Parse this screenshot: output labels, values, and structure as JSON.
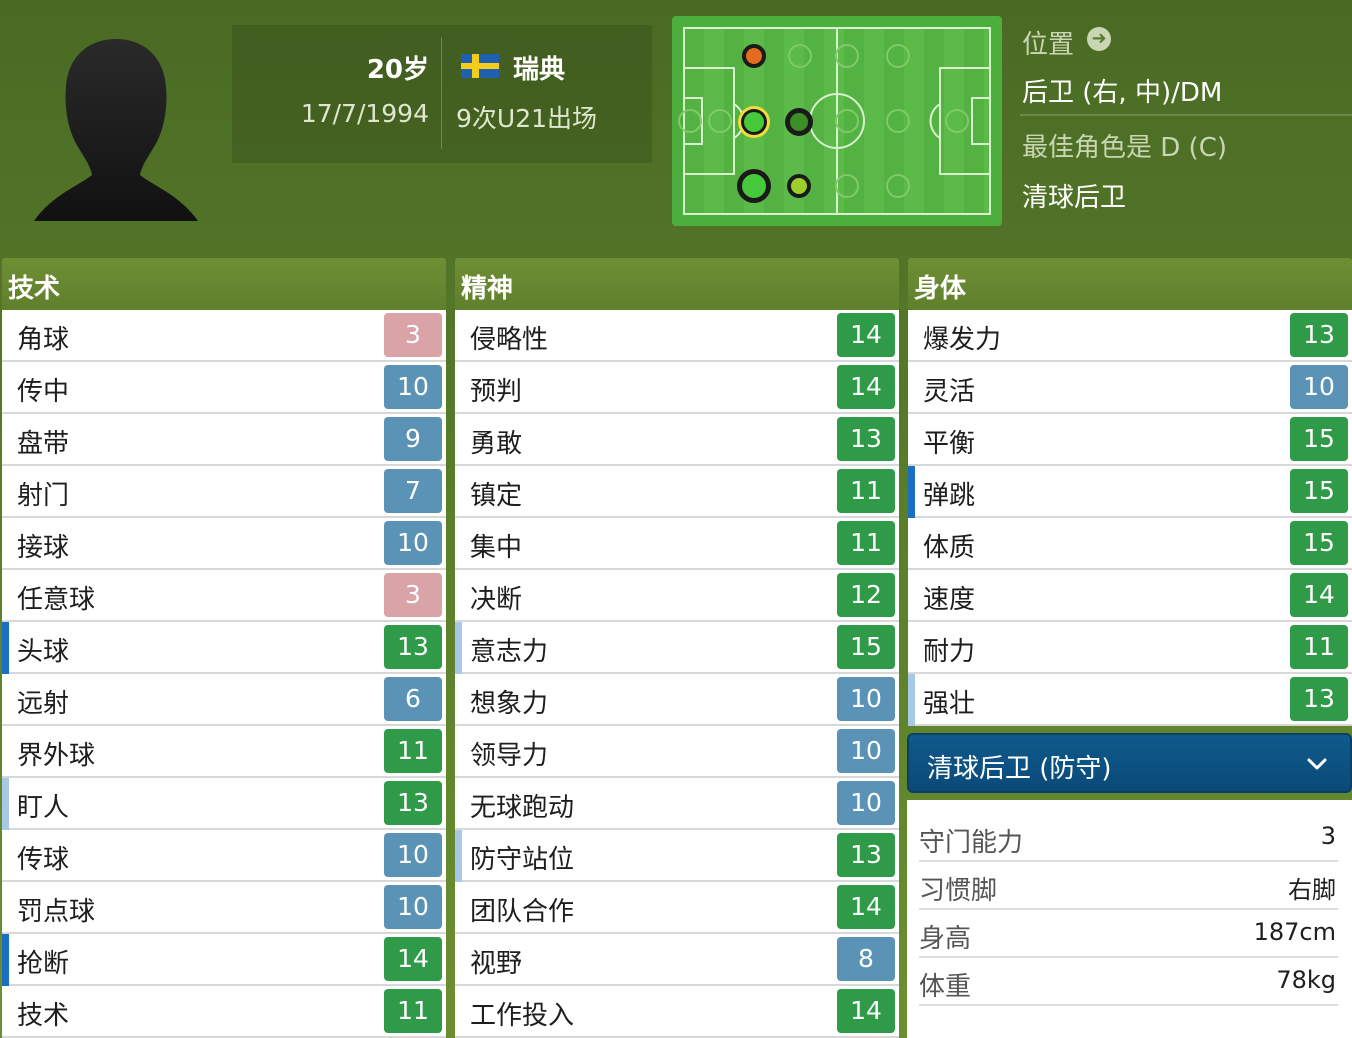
{
  "player": {
    "age": "20岁",
    "dob": "17/7/1994",
    "country": "瑞典",
    "caps": "9次U21出场",
    "flag_colors": {
      "blue": "#1f5fb0",
      "yellow": "#f5cc1a"
    }
  },
  "position": {
    "title": "位置",
    "value": "后卫 (右, 中)/DM",
    "best_role_label": "最佳角色是 D (C)",
    "best_role_value": "清球后卫"
  },
  "technical": {
    "title": "技术",
    "rows": [
      {
        "label": "角球",
        "value": "3",
        "color": "red",
        "mark": ""
      },
      {
        "label": "传中",
        "value": "10",
        "color": "blue",
        "mark": ""
      },
      {
        "label": "盘带",
        "value": "9",
        "color": "blue",
        "mark": ""
      },
      {
        "label": "射门",
        "value": "7",
        "color": "blue",
        "mark": ""
      },
      {
        "label": "接球",
        "value": "10",
        "color": "blue",
        "mark": ""
      },
      {
        "label": "任意球",
        "value": "3",
        "color": "red",
        "mark": ""
      },
      {
        "label": "头球",
        "value": "13",
        "color": "green",
        "mark": "key"
      },
      {
        "label": "远射",
        "value": "6",
        "color": "blue",
        "mark": ""
      },
      {
        "label": "界外球",
        "value": "11",
        "color": "green",
        "mark": ""
      },
      {
        "label": "盯人",
        "value": "13",
        "color": "green",
        "mark": "pref"
      },
      {
        "label": "传球",
        "value": "10",
        "color": "blue",
        "mark": ""
      },
      {
        "label": "罚点球",
        "value": "10",
        "color": "blue",
        "mark": ""
      },
      {
        "label": "抢断",
        "value": "14",
        "color": "green",
        "mark": "key"
      },
      {
        "label": "技术",
        "value": "11",
        "color": "green",
        "mark": ""
      }
    ]
  },
  "mental": {
    "title": "精神",
    "rows": [
      {
        "label": "侵略性",
        "value": "14",
        "color": "green",
        "mark": ""
      },
      {
        "label": "预判",
        "value": "14",
        "color": "green",
        "mark": ""
      },
      {
        "label": "勇敢",
        "value": "13",
        "color": "green",
        "mark": ""
      },
      {
        "label": "镇定",
        "value": "11",
        "color": "green",
        "mark": ""
      },
      {
        "label": "集中",
        "value": "11",
        "color": "green",
        "mark": ""
      },
      {
        "label": "决断",
        "value": "12",
        "color": "green",
        "mark": ""
      },
      {
        "label": "意志力",
        "value": "15",
        "color": "green",
        "mark": "pref"
      },
      {
        "label": "想象力",
        "value": "10",
        "color": "blue",
        "mark": ""
      },
      {
        "label": "领导力",
        "value": "10",
        "color": "blue",
        "mark": ""
      },
      {
        "label": "无球跑动",
        "value": "10",
        "color": "blue",
        "mark": ""
      },
      {
        "label": "防守站位",
        "value": "13",
        "color": "green",
        "mark": "pref"
      },
      {
        "label": "团队合作",
        "value": "14",
        "color": "green",
        "mark": ""
      },
      {
        "label": "视野",
        "value": "8",
        "color": "blue",
        "mark": ""
      },
      {
        "label": "工作投入",
        "value": "14",
        "color": "green",
        "mark": ""
      }
    ]
  },
  "physical": {
    "title": "身体",
    "rows": [
      {
        "label": "爆发力",
        "value": "13",
        "color": "green",
        "mark": ""
      },
      {
        "label": "灵活",
        "value": "10",
        "color": "blue",
        "mark": ""
      },
      {
        "label": "平衡",
        "value": "15",
        "color": "green",
        "mark": ""
      },
      {
        "label": "弹跳",
        "value": "15",
        "color": "green",
        "mark": "key"
      },
      {
        "label": "体质",
        "value": "15",
        "color": "green",
        "mark": ""
      },
      {
        "label": "速度",
        "value": "14",
        "color": "green",
        "mark": ""
      },
      {
        "label": "耐力",
        "value": "11",
        "color": "green",
        "mark": ""
      },
      {
        "label": "强壮",
        "value": "13",
        "color": "green",
        "mark": "pref"
      }
    ]
  },
  "role_dropdown": {
    "selected": "清球后卫 (防守)"
  },
  "details": [
    {
      "key": "守门能力",
      "value": "3"
    },
    {
      "key": "习惯脚",
      "value": "右脚"
    },
    {
      "key": "身高",
      "value": "187cm"
    },
    {
      "key": "体重",
      "value": "78kg"
    }
  ]
}
